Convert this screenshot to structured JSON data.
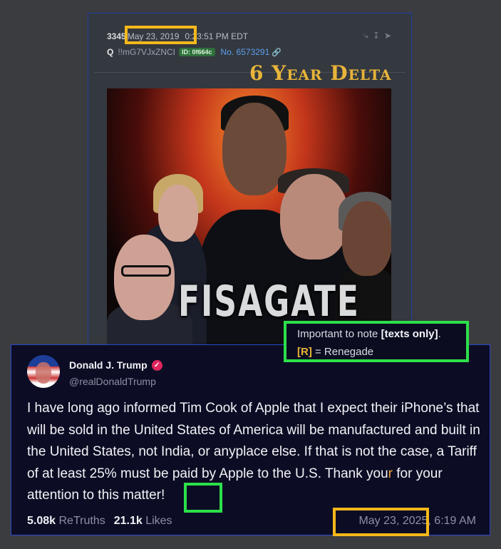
{
  "qpost": {
    "number": "3345",
    "date": "May 23, 2019",
    "time": "0:23:51 PM EDT",
    "name": "Q",
    "tripcode": "!!mG7VJxZNCI",
    "id_badge": "ID: 0f664c",
    "post_no": "No. 6573291",
    "icons": [
      "share-icon",
      "download-icon",
      "arrow-right-icon"
    ]
  },
  "overlay_title": "6 Year Delta",
  "poster": {
    "text": "FISAGATE"
  },
  "truth": {
    "author": "Donald J. Trump",
    "handle": "@realDonaldTrump",
    "text_part1": "I have long ago informed Tim Cook of Apple that I expect their iPhone’s that will be sold in the United  States of America will be manufactured and built in the United States, not India, or anyplace else. If that is not the case, a Tariff of at least 25% must be paid by Apple to the U.S. Thank ",
    "text_you": "you",
    "text_r": "r",
    "text_part2": " for your attention to this matter!",
    "retruths_count": "5.08k",
    "retruths_label": "ReTruths",
    "likes_count": "21.1k",
    "likes_label": "Likes",
    "date": "May 23, 2025, 6:19 AM"
  },
  "note": {
    "line1_prefix": "Important to note ",
    "line1_bold": "[texts only]",
    "line1_suffix": ".",
    "line2_bold": "[R]",
    "line2_rest": " = Renegade"
  },
  "colors": {
    "highlight_orange": "#f4b81a",
    "highlight_green": "#2ce04a",
    "delta_gold": "#e8b43a"
  }
}
